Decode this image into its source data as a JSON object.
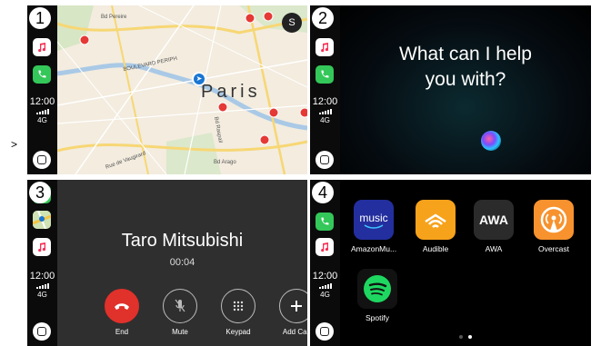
{
  "markers": [
    ">"
  ],
  "panels": [
    {
      "badge": "1",
      "status": {
        "time": "12:00",
        "network": "4G"
      },
      "map": {
        "city_label": "Paris",
        "profile_initial": "S",
        "street_labels": [
          "Bd Pereire",
          "Bd Raspail",
          "Bd Arago",
          "Rue de Vaugirard",
          "BOULEVARD PERIPH"
        ]
      }
    },
    {
      "badge": "2",
      "status": {
        "time": "12:00",
        "network": "4G"
      },
      "siri": {
        "line1": "What can I help",
        "line2": "you with?"
      }
    },
    {
      "badge": "3",
      "status": {
        "time": "12:00",
        "network": "4G"
      },
      "call": {
        "caller": "Taro Mitsubishi",
        "duration": "00:04",
        "buttons": [
          {
            "label": "End",
            "icon": "phone-end-icon"
          },
          {
            "label": "Mute",
            "icon": "microphone-icon"
          },
          {
            "label": "Keypad",
            "icon": "keypad-icon"
          },
          {
            "label": "Add Call",
            "icon": "plus-icon"
          }
        ]
      }
    },
    {
      "badge": "4",
      "status": {
        "time": "12:00",
        "network": "4G"
      },
      "apps": [
        {
          "label": "AmazonMu...",
          "tile_text": "music",
          "color": "#232f9e"
        },
        {
          "label": "Audible",
          "tile_text": "",
          "color": "#f7a21b"
        },
        {
          "label": "AWA",
          "tile_text": "AWA",
          "color": "#2b2b2b"
        },
        {
          "label": "Overcast",
          "tile_text": "",
          "color": "#f7922f"
        },
        {
          "label": "Spotify",
          "tile_text": "",
          "color": "#1ed760"
        }
      ],
      "page_dots": {
        "count": 2,
        "active": 2
      }
    }
  ],
  "colors": {
    "end_call": "#e0312b",
    "phone_green": "#34c759",
    "location_blue": "#1976d2"
  }
}
